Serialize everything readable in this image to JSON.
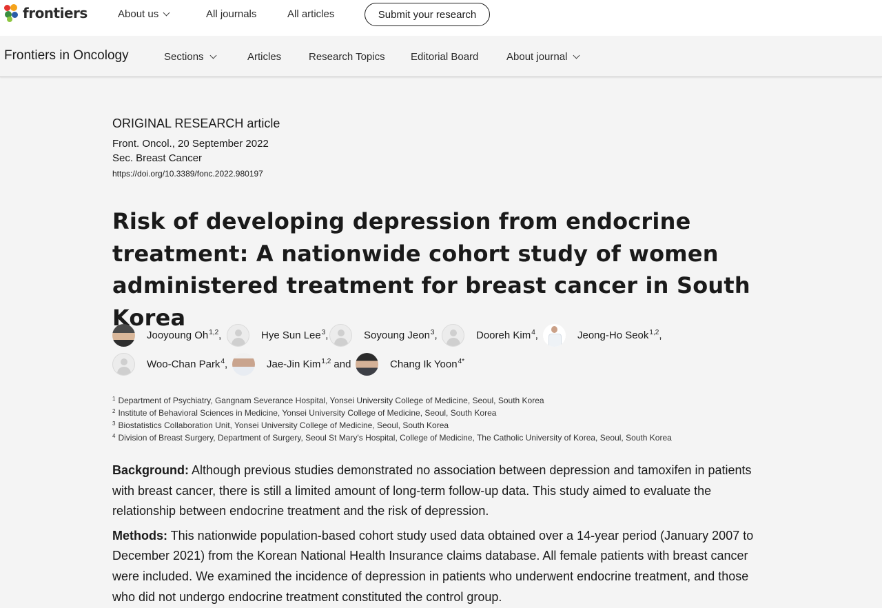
{
  "site": {
    "logo_text": "frontiers",
    "nav": [
      {
        "label": "About us",
        "has_dropdown": true
      },
      {
        "label": "All journals",
        "has_dropdown": false
      },
      {
        "label": "All articles",
        "has_dropdown": false
      }
    ],
    "submit_label": "Submit your research"
  },
  "journal": {
    "name": "Frontiers in Oncology",
    "nav": [
      {
        "label": "Sections",
        "has_dropdown": true
      },
      {
        "label": "Articles",
        "has_dropdown": false
      },
      {
        "label": "Research Topics",
        "has_dropdown": false
      },
      {
        "label": "Editorial Board",
        "has_dropdown": false
      },
      {
        "label": "About journal",
        "has_dropdown": true
      }
    ]
  },
  "article": {
    "type": "ORIGINAL RESEARCH article",
    "citation": "Front. Oncol., 20 September 2022",
    "section": "Sec. Breast Cancer",
    "doi": "https://doi.org/10.3389/fonc.2022.980197",
    "title": "Risk of developing depression from endocrine treatment: A nationwide cohort study of women administered treatment for breast cancer in South Korea",
    "authors": [
      {
        "name": "Jooyoung Oh",
        "sup": "1,2",
        "suffix": ",",
        "avatar": "photo"
      },
      {
        "name": "Hye Sun Lee",
        "sup": "3",
        "suffix": ",",
        "avatar": "placeholder"
      },
      {
        "name": "Soyoung Jeon",
        "sup": "3",
        "suffix": ",",
        "avatar": "placeholder"
      },
      {
        "name": "Dooreh Kim",
        "sup": "4",
        "suffix": ",",
        "avatar": "placeholder"
      },
      {
        "name": "Jeong-Ho Seok",
        "sup": "1,2",
        "suffix": ",",
        "avatar": "photo"
      },
      {
        "name": "Woo-Chan Park",
        "sup": "4",
        "suffix": ",",
        "avatar": "placeholder"
      },
      {
        "name": "Jae-Jin Kim",
        "sup": "1,2",
        "suffix": " and",
        "avatar": "photo"
      },
      {
        "name": "Chang Ik Yoon",
        "sup": "4*",
        "suffix": "",
        "avatar": "photo"
      }
    ],
    "affiliations": [
      {
        "num": "1",
        "text": "Department of Psychiatry, Gangnam Severance Hospital, Yonsei University College of Medicine, Seoul, South Korea"
      },
      {
        "num": "2",
        "text": "Institute of Behavioral Sciences in Medicine, Yonsei University College of Medicine, Seoul, South Korea"
      },
      {
        "num": "3",
        "text": "Biostatistics Collaboration Unit, Yonsei University College of Medicine, Seoul, South Korea"
      },
      {
        "num": "4",
        "text": "Division of Breast Surgery, Department of Surgery, Seoul St Mary's Hospital, College of Medicine, The Catholic University of Korea, Seoul, South Korea"
      }
    ],
    "abstract": {
      "background_label": "Background:",
      "background_text": " Although previous studies demonstrated no association between depression and tamoxifen in patients with breast cancer, there is still a limited amount of long-term follow-up data. This study aimed to evaluate the relationship between endocrine treatment and the risk of depression.",
      "methods_label": "Methods:",
      "methods_text": " This nationwide population-based cohort study used data obtained over a 14-year period (January 2007 to December 2021) from the Korean National Health Insurance claims database. All female patients with breast cancer were included. We examined the incidence of depression in patients who underwent endocrine treatment, and those who did not undergo endocrine treatment constituted the control group."
    }
  },
  "colors": {
    "logo_dots": [
      "#e4332e",
      "#f5a31a",
      "#3a8d3f",
      "#2a5ca8",
      "#8dc63f"
    ]
  }
}
